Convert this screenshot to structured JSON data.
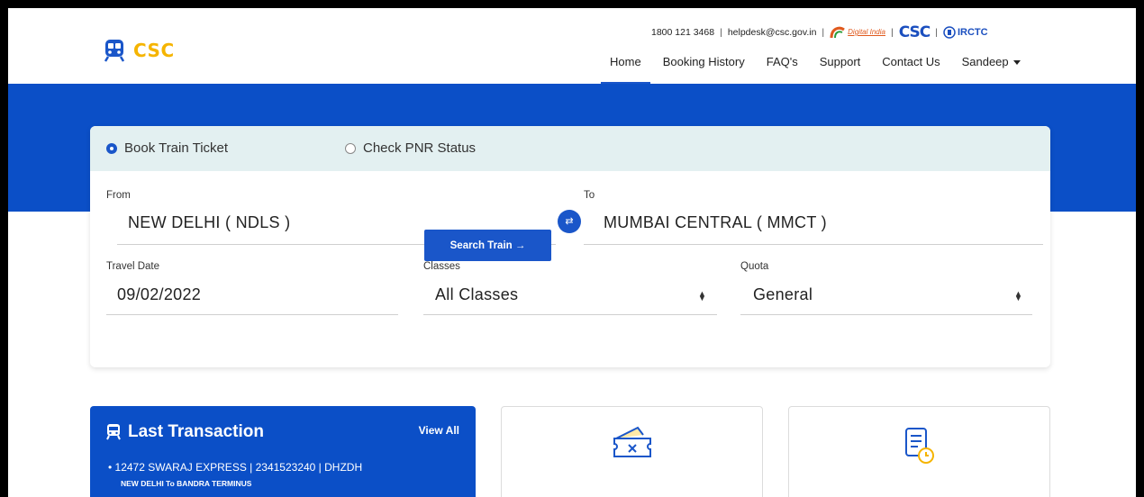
{
  "header": {
    "brand": "CSC",
    "phone": "1800 121 3468",
    "email": "helpdesk@csc.gov.in",
    "digital_india": "Digital India",
    "csc_logo": "CSC",
    "irctc_logo": "IRCTC",
    "nav": [
      {
        "label": "Home",
        "active": true
      },
      {
        "label": "Booking History"
      },
      {
        "label": "FAQ's"
      },
      {
        "label": "Support"
      },
      {
        "label": "Contact Us"
      },
      {
        "label": "Sandeep"
      }
    ]
  },
  "search": {
    "tabs": {
      "book": "Book Train Ticket",
      "pnr": "Check PNR Status",
      "selected": "book"
    },
    "from_label": "From",
    "from_value": "NEW DELHI ( NDLS )",
    "to_label": "To",
    "to_value": "MUMBAI CENTRAL ( MMCT )",
    "date_label": "Travel Date",
    "date_value": "09/02/2022",
    "classes_label": "Classes",
    "classes_value": "All Classes",
    "quota_label": "Quota",
    "quota_value": "General",
    "search_button": "Search Train →"
  },
  "last_transaction": {
    "title": "Last Transaction",
    "view_all": "View All",
    "item": "• 12472 SWARAJ EXPRESS  |  2341523240  |  DHZDH",
    "route": "NEW DELHI To BANDRA TERMINUS"
  },
  "icons": {
    "brand": "train-icon",
    "tile1": "cancel-ticket-icon",
    "tile2": "history-icon"
  },
  "colors": {
    "primary": "#0b4fc7",
    "accent": "#f5b400",
    "panel": "#e3f0f1"
  }
}
